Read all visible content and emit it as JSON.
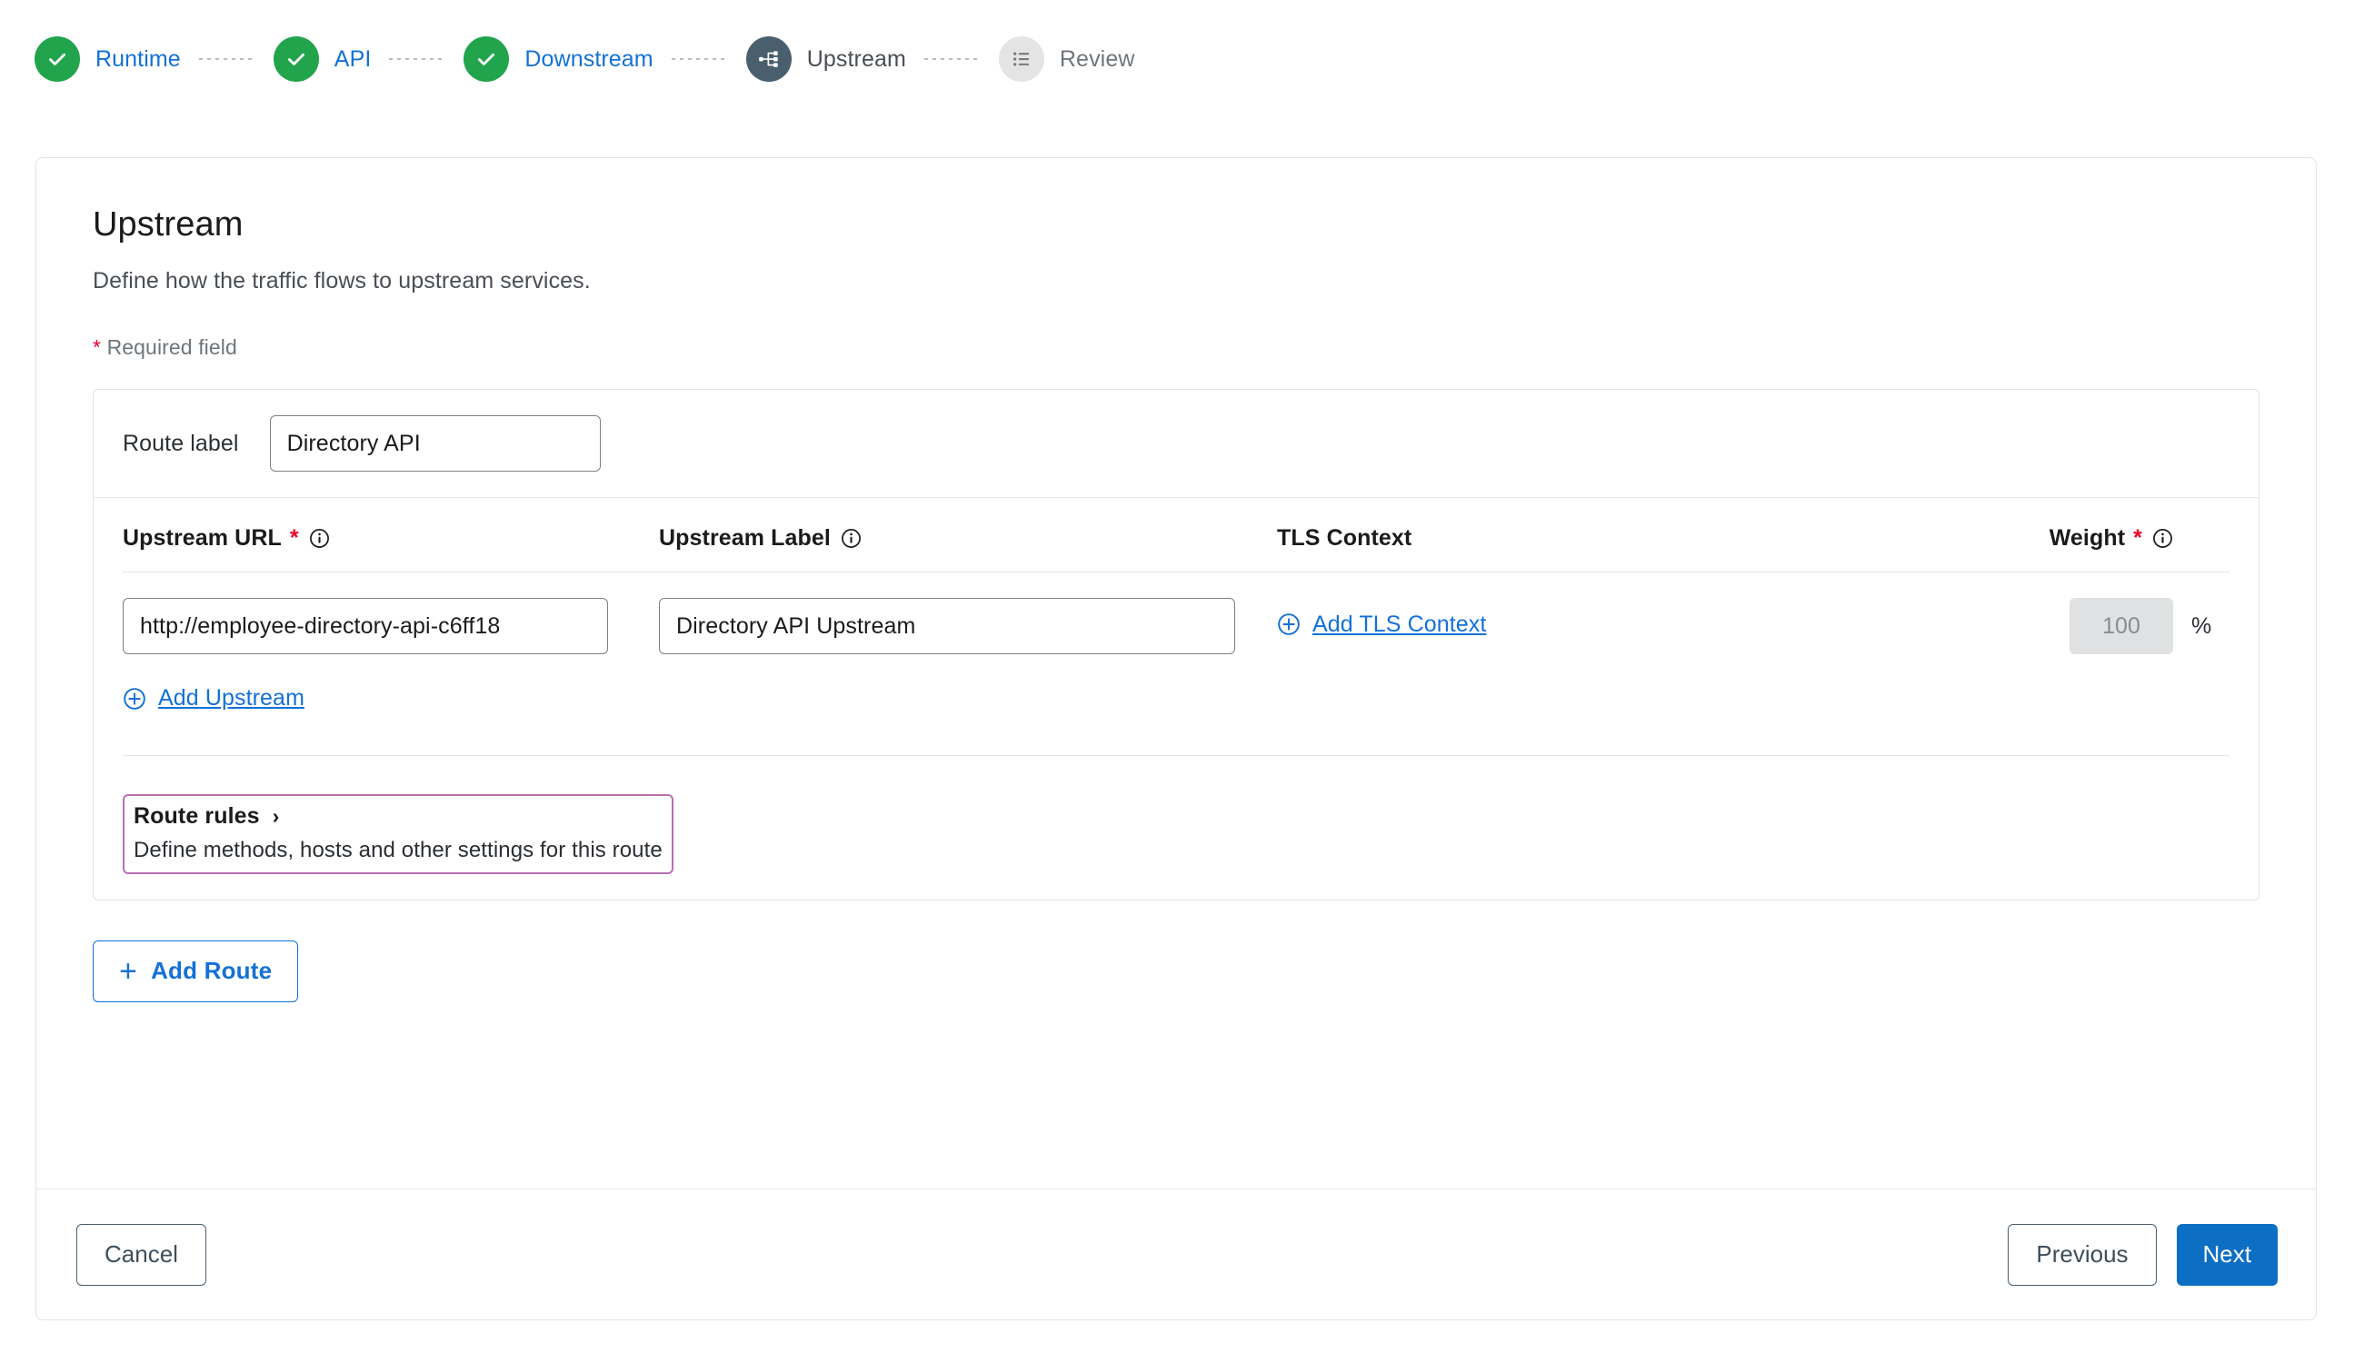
{
  "stepper": {
    "steps": [
      {
        "label": "Runtime",
        "state": "done",
        "icon": "check-icon"
      },
      {
        "label": "API",
        "state": "done",
        "icon": "check-icon"
      },
      {
        "label": "Downstream",
        "state": "done",
        "icon": "check-icon"
      },
      {
        "label": "Upstream",
        "state": "current",
        "icon": "topology-icon"
      },
      {
        "label": "Review",
        "state": "todo",
        "icon": "list-icon"
      }
    ]
  },
  "page": {
    "title": "Upstream",
    "description": "Define how the traffic flows to upstream services.",
    "required_note_star": "*",
    "required_note": "Required field"
  },
  "route": {
    "route_label_text": "Route label",
    "route_label_value": "Directory API",
    "route_label_placeholder": "Route label",
    "headers": {
      "upstream_url": "Upstream URL",
      "upstream_url_star": "*",
      "upstream_label": "Upstream Label",
      "tls_context": "TLS Context",
      "weight": "Weight",
      "weight_star": "*"
    },
    "upstreams": [
      {
        "url": "http://employee-directory-api-c6ff18",
        "url_placeholder": "Upstream URL",
        "label": "Directory API Upstream",
        "label_placeholder": "Upstream Label",
        "tls_link": "Add TLS Context",
        "weight": "100",
        "weight_unit": "%"
      }
    ],
    "add_upstream_link": "Add Upstream",
    "rules": {
      "title": "Route rules",
      "chevron": "›",
      "description": "Define methods, hosts and other settings for this route",
      "highlight_color": "#b96fb4"
    }
  },
  "actions": {
    "add_route": "Add Route",
    "add_route_plus": "+",
    "cancel": "Cancel",
    "previous": "Previous",
    "next": "Next"
  },
  "colors": {
    "step_done": "#21a44c",
    "step_current": "#4a5f6e",
    "step_todo": "#e4e4e4",
    "link_blue": "#1371d6",
    "primary_blue": "#0d6fc4",
    "required_red": "#e4002b"
  }
}
